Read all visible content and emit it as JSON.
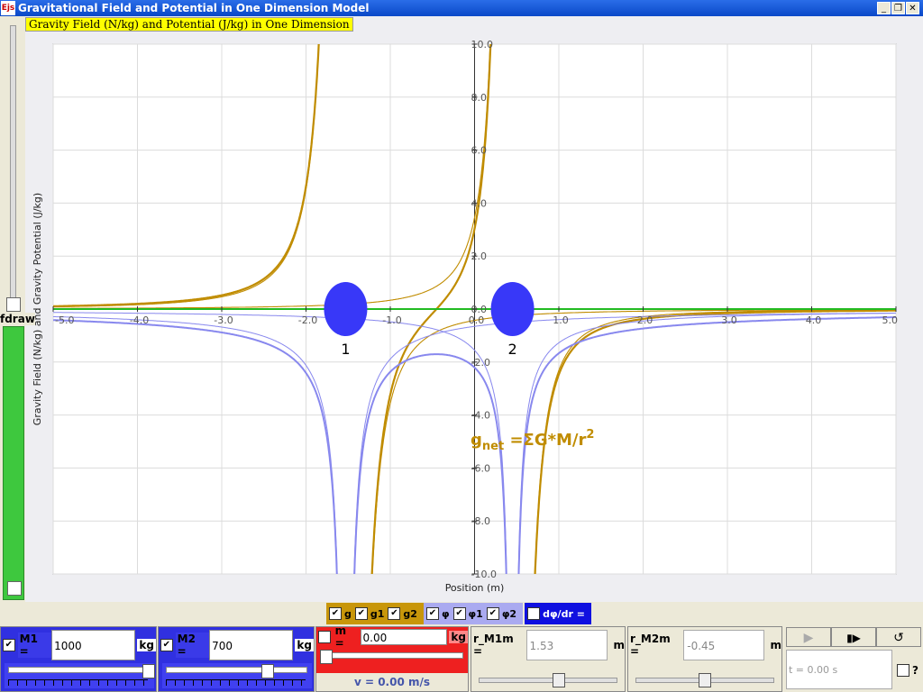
{
  "window": {
    "title": "Gravitational Field and Potential in One Dimension Model",
    "icon_text": "Ejs",
    "buttons": [
      "_",
      "❐",
      "✕"
    ]
  },
  "left_panel": {
    "label": "fdraw"
  },
  "chart_data": {
    "type": "line",
    "title": "Gravity Field (N/kg) and Potential (J/kg) in One Dimension",
    "xlabel": "Position (m)",
    "ylabel": "Gravity Field (N/kg) and Gravity Potential (J/kg)",
    "xlim": [
      -5.0,
      5.0
    ],
    "ylim": [
      -10.0,
      10.0
    ],
    "x_ticks": [
      "-5.0",
      "-4.0",
      "-3.0",
      "-2.0",
      "-1.0",
      "0.0",
      "1.0",
      "2.0",
      "3.0",
      "4.0",
      "5.0"
    ],
    "y_ticks": [
      "10.0",
      "8.0",
      "6.0",
      "4.0",
      "2.0",
      "0.0",
      "-2.0",
      "-4.0",
      "-6.0",
      "-8.0",
      "-10.0"
    ],
    "grid": true,
    "masses": [
      {
        "label": "1",
        "x": -1.53,
        "color": "#3838f8"
      },
      {
        "label": "2",
        "x": 0.45,
        "color": "#3838f8"
      }
    ],
    "annotation": "g",
    "annotation_sub": "net",
    "annotation_rest": " =ΣG*M/r",
    "annotation_sup": "2",
    "series": [
      {
        "name": "g",
        "color": "#c08c00"
      },
      {
        "name": "g1",
        "color": "#c08c00"
      },
      {
        "name": "g2",
        "color": "#c08c00"
      },
      {
        "name": "φ",
        "color": "#8888ee"
      },
      {
        "name": "φ1",
        "color": "#8888ee"
      },
      {
        "name": "φ2",
        "color": "#8888ee"
      },
      {
        "name": "dφ/dr",
        "color": "#22bb22"
      }
    ]
  },
  "legend": {
    "g_items": [
      {
        "label": "g",
        "checked": "✔"
      },
      {
        "label": "g1",
        "checked": "✔"
      },
      {
        "label": "g2",
        "checked": "✔"
      }
    ],
    "phi_items": [
      {
        "label": "φ",
        "checked": "✔"
      },
      {
        "label": "φ1",
        "checked": "✔"
      },
      {
        "label": "φ2",
        "checked": "✔"
      }
    ],
    "deriv_item": {
      "label": "dφ/dr =",
      "checked": ""
    }
  },
  "controls": {
    "m1": {
      "label": "M1 =",
      "value": "1000",
      "unit": "kg",
      "checked": "✔",
      "slider": 0.95
    },
    "m2": {
      "label": "M2 =",
      "value": "700",
      "unit": "kg",
      "checked": "✔",
      "slider": 0.7
    },
    "m": {
      "label": "m =",
      "value": "0.00",
      "unit": "kg",
      "checked": "",
      "slider": 0.0
    },
    "v_text": "v = 0.00 m/s",
    "r_m1m": {
      "label": "r_M1m =",
      "value": "1.53",
      "unit": "m",
      "slider": 0.5
    },
    "r_m2m": {
      "label": "r_M2m =",
      "value": "-0.45",
      "unit": "m",
      "slider": 0.5
    },
    "time_text": "t = 0.00 s",
    "help_label": "?",
    "play_icon": "▶",
    "step_icon": "▮▶",
    "reset_icon": "↺"
  },
  "colors": {
    "gold": "#c08c00",
    "lavender": "#8888ee",
    "green": "#22bb22",
    "mass": "#3838f8",
    "red": "#ee2020"
  }
}
